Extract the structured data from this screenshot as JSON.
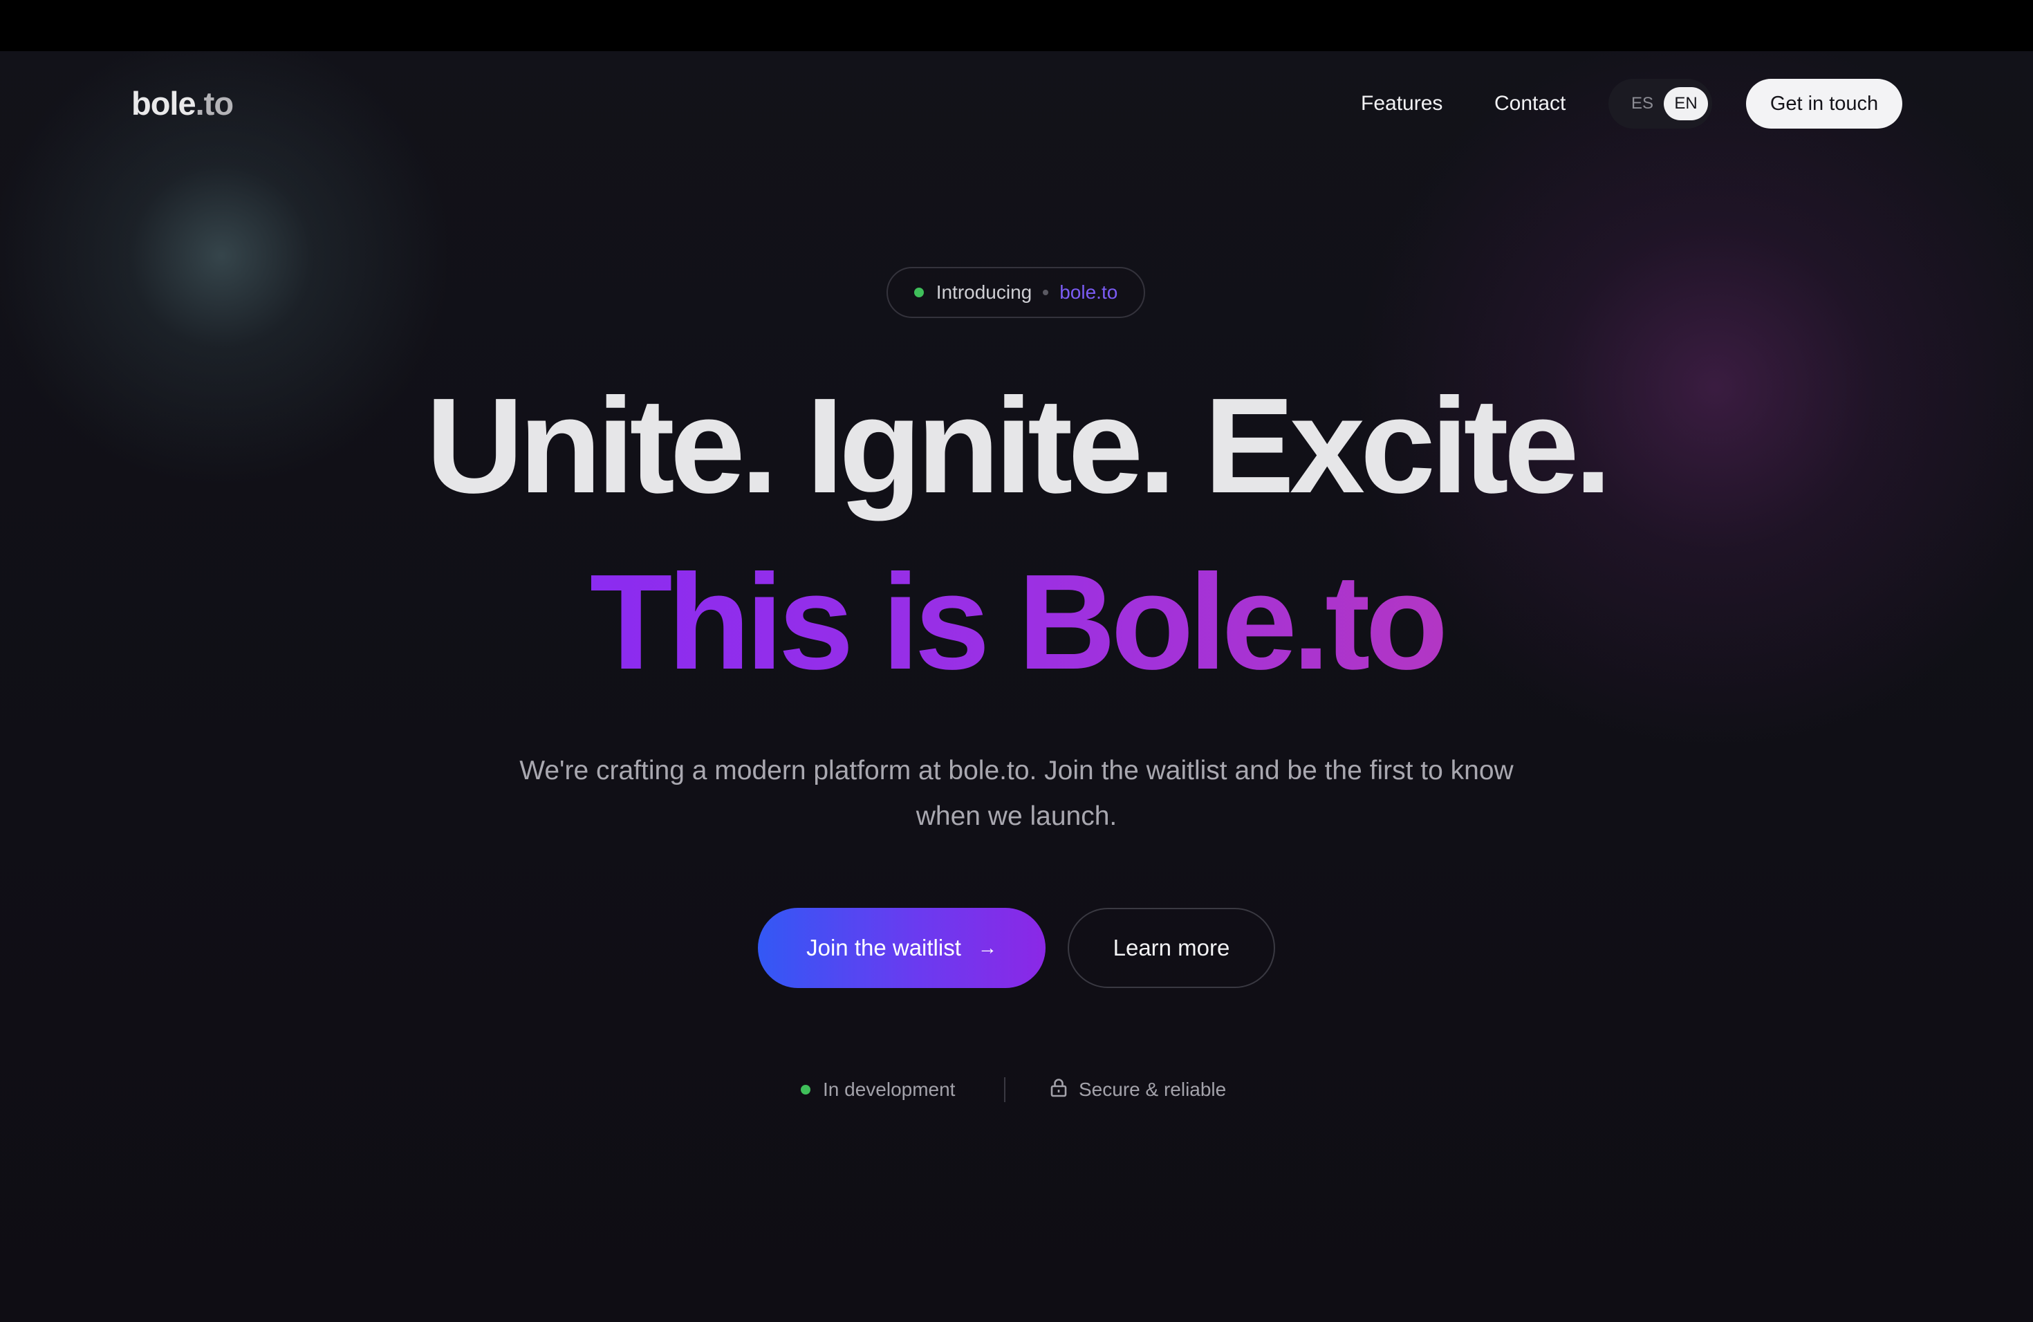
{
  "nav": {
    "logo_main": "bole",
    "logo_tld": ".to",
    "links": [
      "Features",
      "Contact"
    ],
    "lang": {
      "es": "ES",
      "en": "EN",
      "active": "EN"
    },
    "cta": "Get in touch"
  },
  "hero": {
    "badge": {
      "intro": "Introducing",
      "brand": "bole.to"
    },
    "headline": "Unite. Ignite. Excite.",
    "headline_accent": "This is Bole.to",
    "subtitle": "We're crafting a modern platform at bole.to. Join the waitlist and be the first to know when we launch.",
    "primary_button": "Join the waitlist",
    "primary_arrow": "→",
    "secondary_button": "Learn more",
    "status_dev": "In development",
    "status_secure": "Secure & reliable"
  },
  "colors": {
    "background": "#0f0e14",
    "accent_purple": "#8b2cf0",
    "accent_blue": "#3358f5",
    "status_green": "#3fbf5a"
  },
  "icons": [
    "status-dot-icon",
    "arrow-right-icon",
    "lock-icon"
  ]
}
